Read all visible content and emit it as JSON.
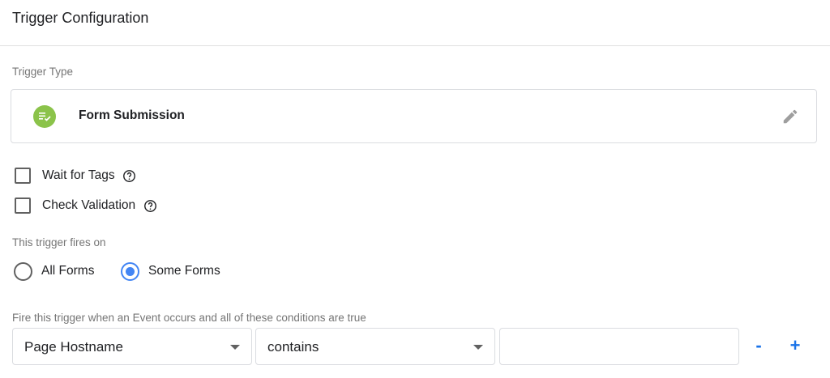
{
  "header": {
    "title": "Trigger Configuration"
  },
  "trigger_type": {
    "label": "Trigger Type",
    "name": "Form Submission",
    "icon": "form-submission-icon",
    "icon_color": "#8bc34a"
  },
  "options": [
    {
      "label": "Wait for Tags",
      "checked": false
    },
    {
      "label": "Check Validation",
      "checked": false
    }
  ],
  "fires_on": {
    "label": "This trigger fires on",
    "options": [
      {
        "label": "All Forms",
        "selected": false
      },
      {
        "label": "Some Forms",
        "selected": true
      }
    ],
    "accent": "#4285f4"
  },
  "conditions": {
    "label": "Fire this trigger when an Event occurs and all of these conditions are true",
    "variable": "Page Hostname",
    "operator": "contains",
    "value": "",
    "remove_label": "-",
    "add_label": "+"
  }
}
